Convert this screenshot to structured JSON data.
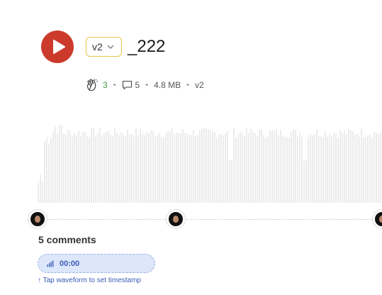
{
  "track": {
    "title": "_222",
    "version": "v2",
    "play_icon": "play-icon"
  },
  "meta": {
    "clap_icon": "clap-icon",
    "claps": "3",
    "comment_icon": "comment-icon",
    "comments": "5",
    "size": "4.8 MB",
    "version": "v2",
    "separator": "•"
  },
  "comments": {
    "heading": "5 comments",
    "timestamp": "00:00",
    "timestamp_icon": "waveform-bars-icon",
    "hint": "↑ Tap waveform to set timestamp"
  },
  "colors": {
    "play": "#cc3a2c",
    "version_border": "#e8c64a",
    "clap_count": "#3a9a3a",
    "pill_bg": "#dde7fb",
    "pill_text": "#3a5bb5"
  }
}
